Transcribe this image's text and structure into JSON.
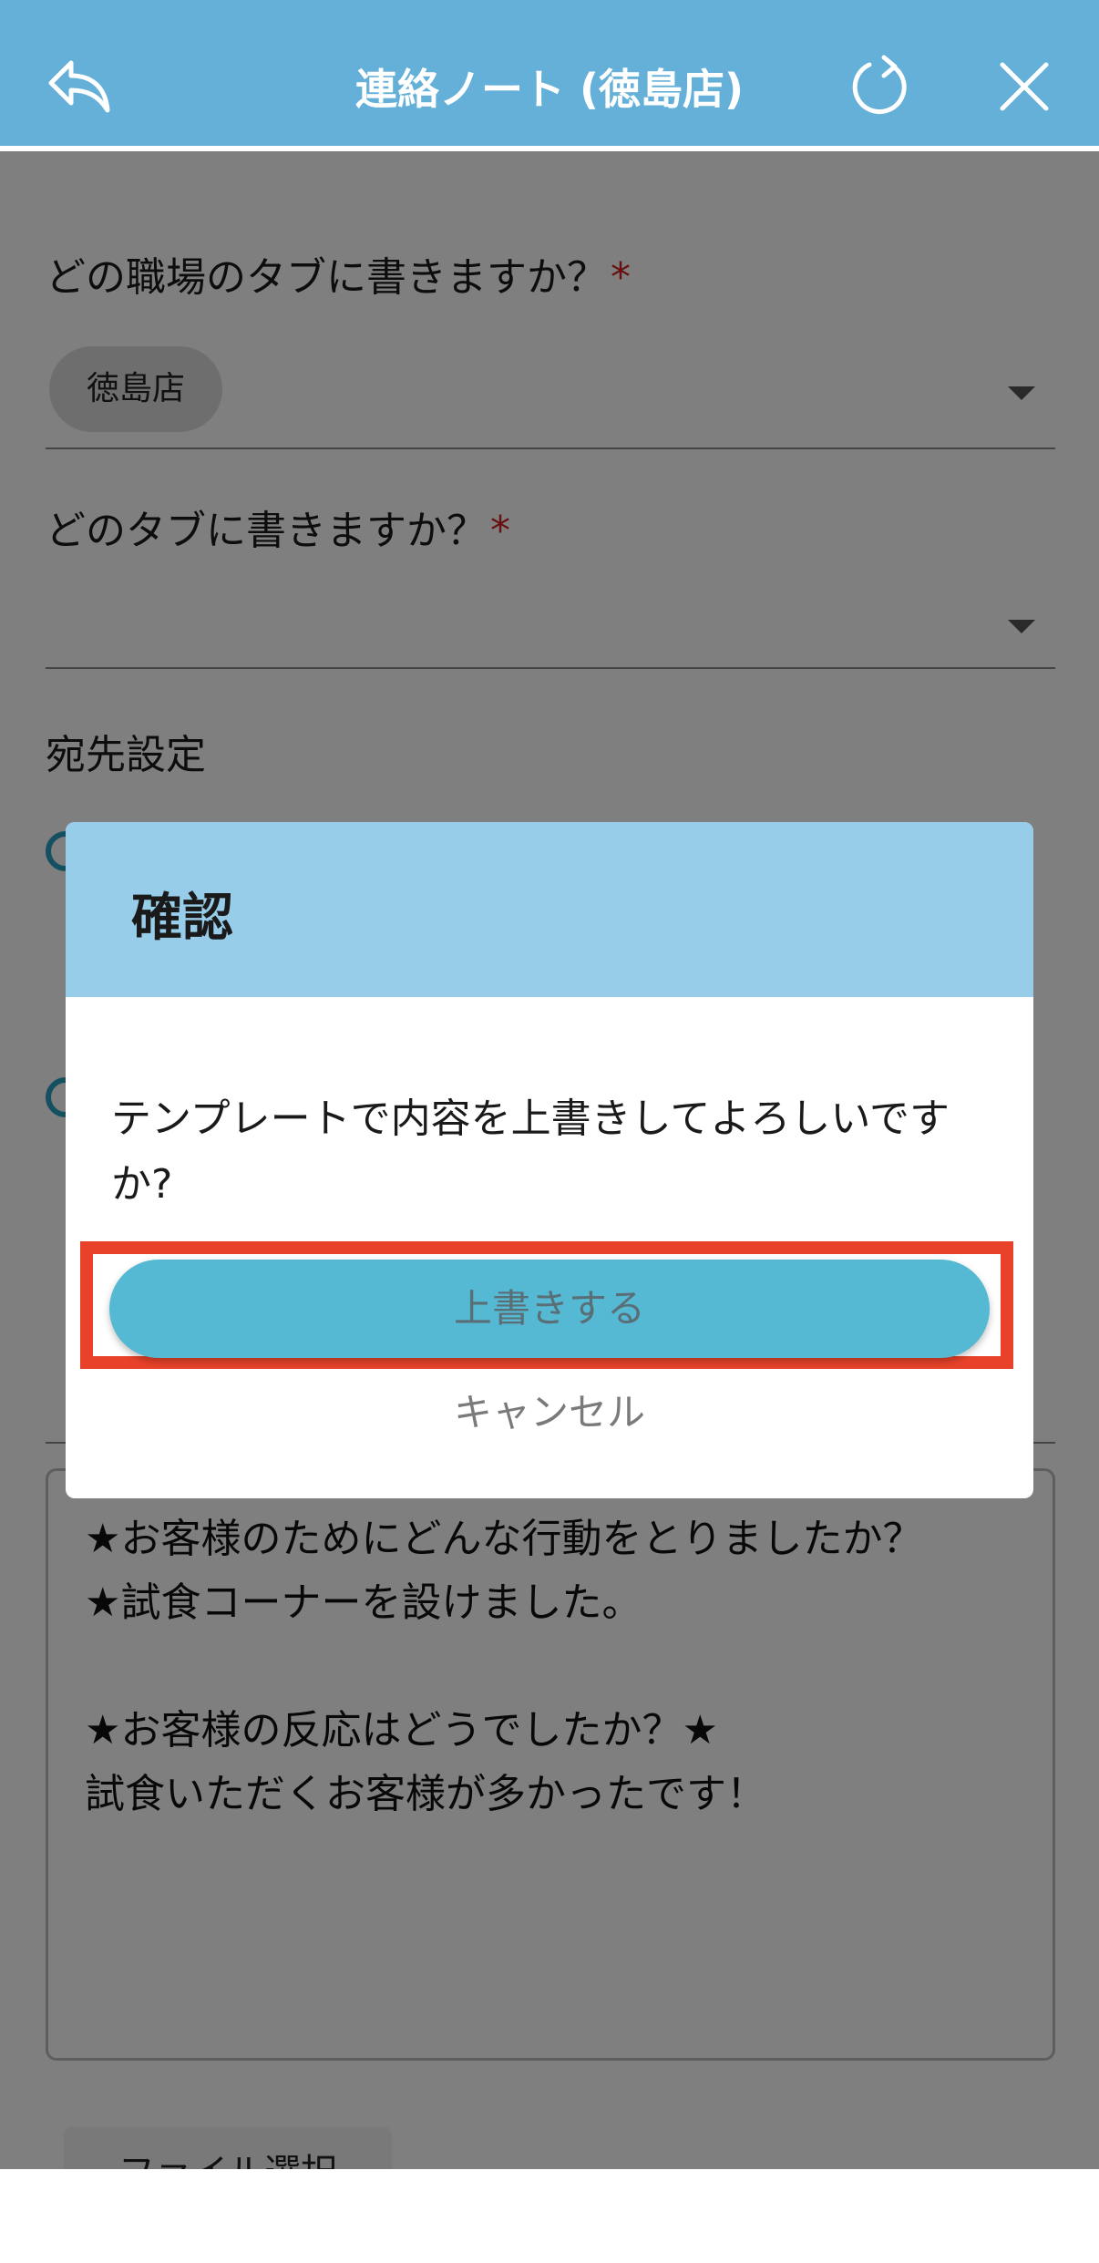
{
  "header": {
    "title": "連絡ノート (徳島店)",
    "back_icon": "reply-arrow-icon",
    "refresh_icon": "refresh-icon",
    "close_icon": "close-icon",
    "background": "#64b0d8"
  },
  "form": {
    "workplace_label": "どの職場のタブに書きますか？",
    "workplace_required": "*",
    "workplace_chip": "徳島店",
    "tab_label": "どのタブに書きますか？",
    "tab_required": "*",
    "recipient_label": "宛先設定",
    "content_text": "★お客様のためにどんな行動をとりましたか？\n★試食コーナーを設けました。\n\n★お客様の反応はどうでしたか？★\n試食いただくお客様が多かったです！",
    "file_button": "ファイル選択"
  },
  "dialog": {
    "title": "確認",
    "message": "テンプレートで内容を上書きしてよろしいですか?",
    "confirm_label": "上書きする",
    "cancel_label": "キャンセル",
    "header_color": "#98cdea",
    "button_color": "#56b9d3",
    "highlight_color": "#e8432a"
  }
}
